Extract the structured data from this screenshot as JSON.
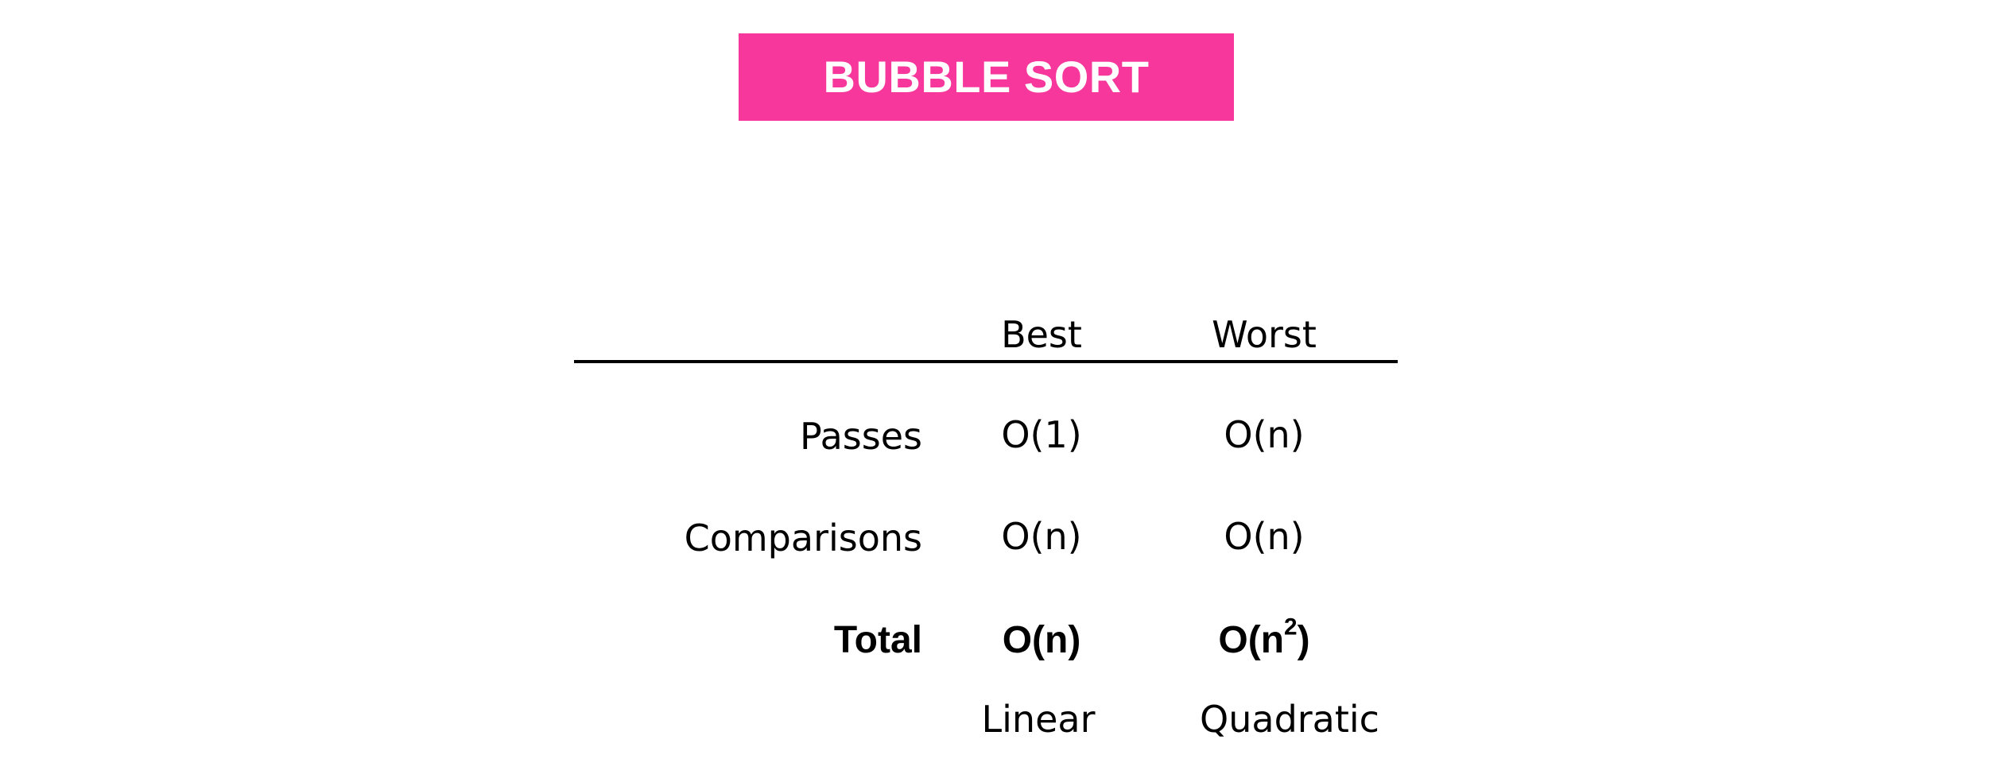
{
  "title": "BUBBLE SORT",
  "colors": {
    "banner": "#f7379b",
    "banner_text": "#ffffff",
    "text": "#000000"
  },
  "table": {
    "columns": [
      "Best",
      "Worst"
    ],
    "rows": [
      {
        "label": "Passes",
        "best": "O(1)",
        "worst": "O(n)"
      },
      {
        "label": "Comparisons",
        "best": "O(n)",
        "worst": "O(n)"
      },
      {
        "label": "Total",
        "best": "O(n)",
        "worst_base": "O(n",
        "worst_exponent": "2",
        "worst_close": ")"
      }
    ],
    "descriptors": {
      "best": "Linear",
      "worst": "Quadratic"
    }
  }
}
